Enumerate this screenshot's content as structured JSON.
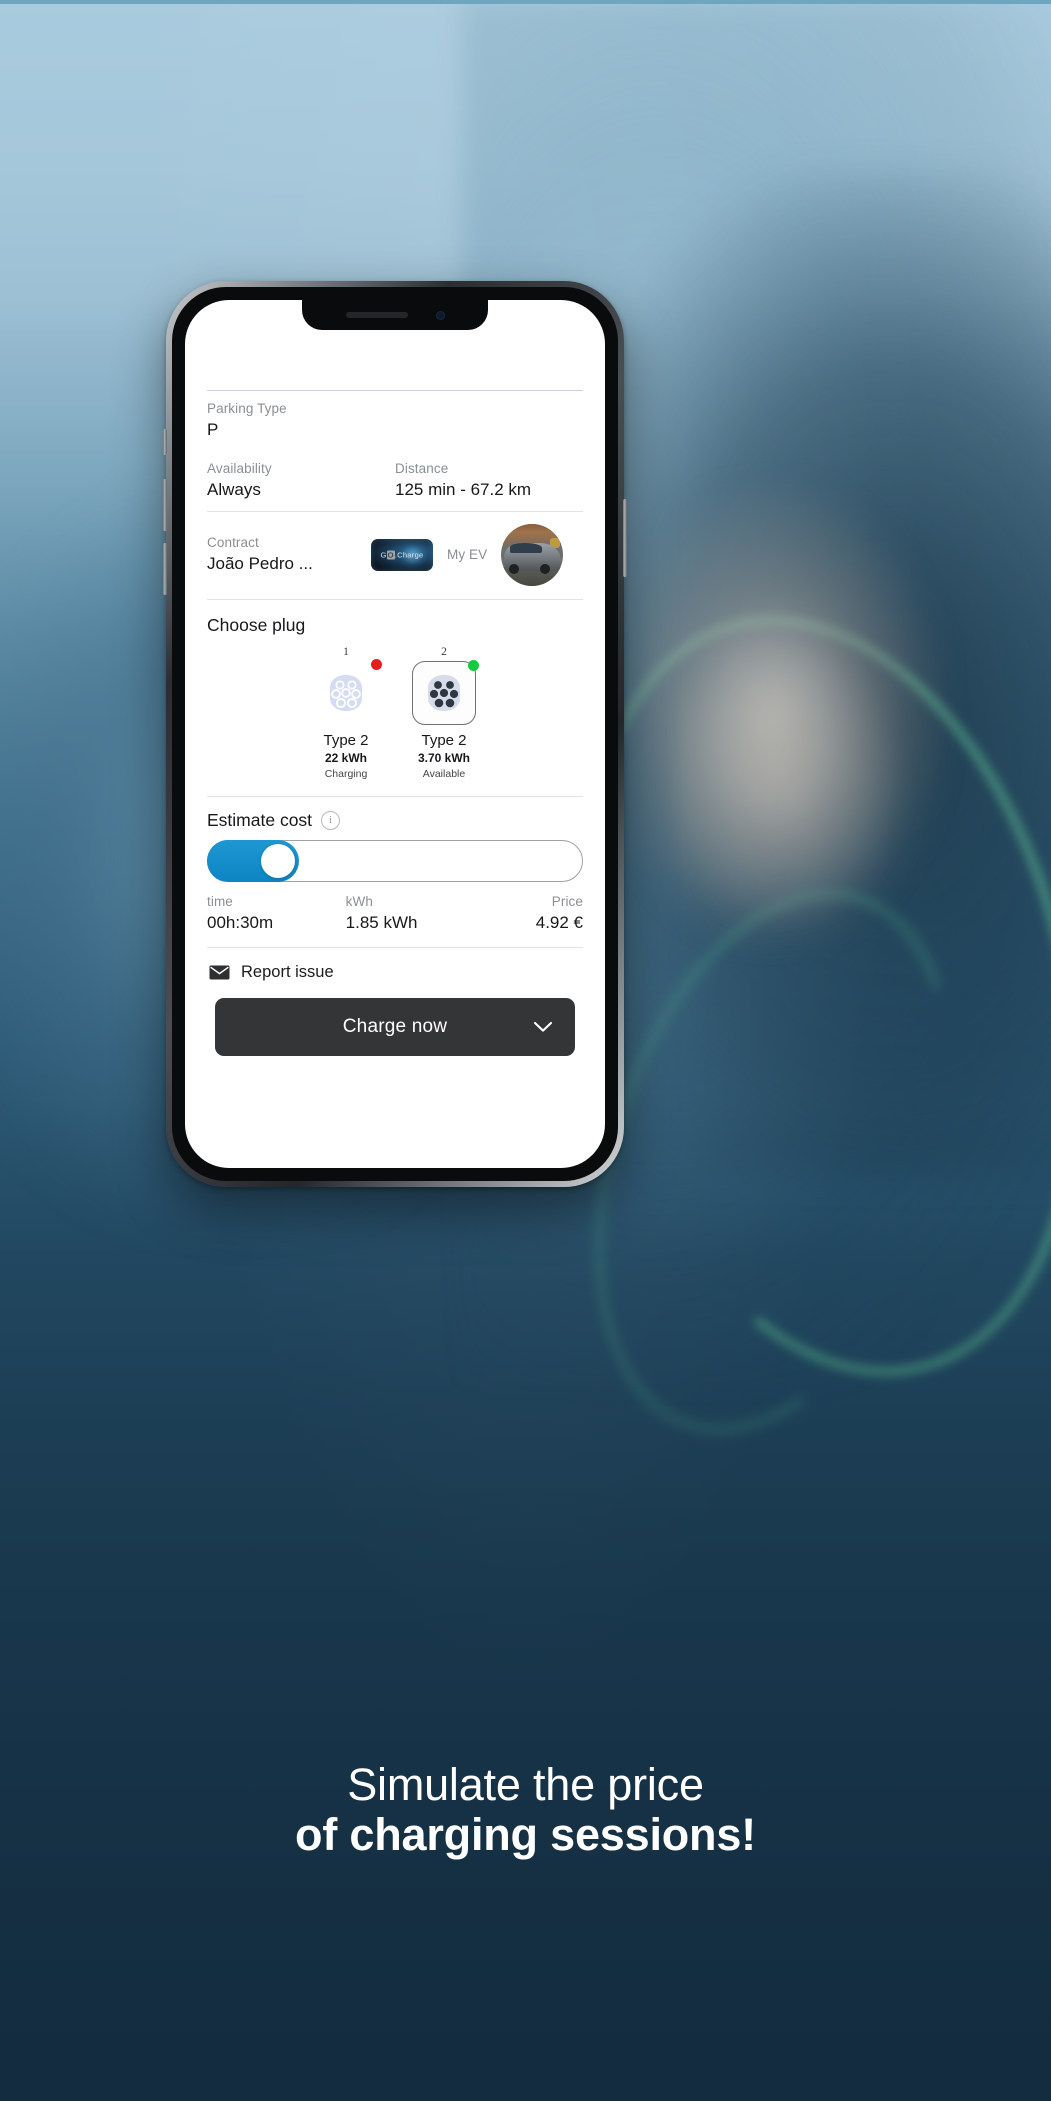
{
  "background": {
    "gradient_top": "#a9cbde",
    "gradient_bottom": "#1b3a50",
    "cable_color": "#60c496"
  },
  "phone": {
    "notch": {
      "speaker_icon": "speaker-grille-icon",
      "camera_icon": "front-camera-icon"
    },
    "side_buttons": [
      "mute-switch",
      "volume-up-button",
      "volume-down-button",
      "power-button"
    ]
  },
  "screen": {
    "details": {
      "parking": {
        "label": "Parking Type",
        "value": "P"
      },
      "availability": {
        "label": "Availability",
        "value": "Always"
      },
      "distance": {
        "label": "Distance",
        "value": "125 min - 67.2 km"
      },
      "contract": {
        "label": "Contract",
        "value": "João Pedro ..."
      },
      "operator_badge": {
        "icon": "gocharge-logo-icon",
        "text_pre": "G",
        "text_chip": "O",
        "text_post": ".Charge"
      },
      "my_ev": {
        "label": "My EV",
        "avatar_icon": "vehicle-avatar-icon"
      }
    },
    "choose_plug": {
      "title": "Choose plug",
      "plugs": [
        {
          "number": "1",
          "name": "Type 2",
          "power": "22 kWh",
          "state": "Charging",
          "status_color": "#e81c1c",
          "selected": false,
          "icon": "type2-plug-icon"
        },
        {
          "number": "2",
          "name": "Type 2",
          "power": "3.70 kWh",
          "state": "Available",
          "status_color": "#17c93f",
          "selected": true,
          "icon": "type2-plug-icon"
        }
      ]
    },
    "estimate": {
      "title": "Estimate cost",
      "info_icon": "info-icon",
      "info_glyph": "i",
      "toggle": {
        "name": "estimate-cost-toggle",
        "state": "on",
        "accent": "#0e85c3"
      },
      "time": {
        "label": "time",
        "value": "00h:30m"
      },
      "energy": {
        "label": "kWh",
        "value": "1.85 kWh"
      },
      "price": {
        "label": "Price",
        "value": "4.92 €"
      }
    },
    "footer": {
      "report": {
        "icon": "mail-icon",
        "label": "Report issue"
      },
      "cta": {
        "label": "Charge now",
        "chevron_icon": "chevron-down-icon",
        "bg": "#333537"
      }
    }
  },
  "caption": {
    "line1": "Simulate the price",
    "line2": "of charging sessions!"
  }
}
